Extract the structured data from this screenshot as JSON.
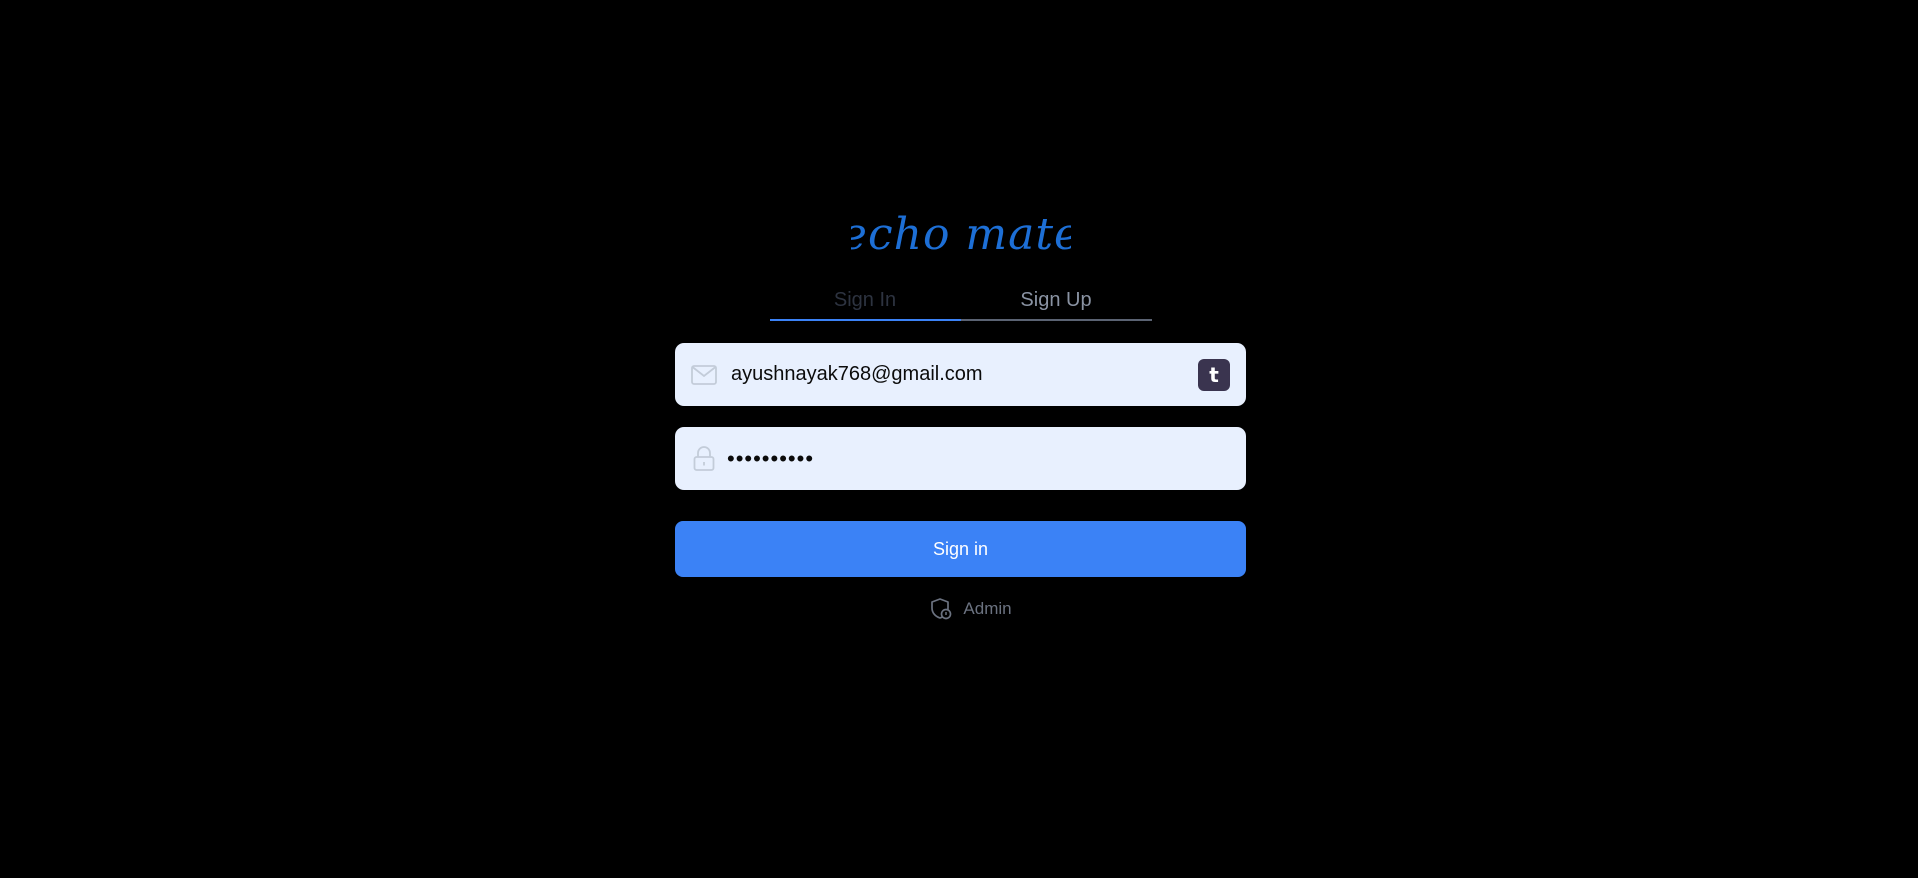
{
  "brand": {
    "logo_text": "echo mate",
    "accent_color": "#3b82f6",
    "logo_color": "#1d6fd6"
  },
  "tabs": [
    {
      "label": "Sign In",
      "active": true
    },
    {
      "label": "Sign Up",
      "active": false
    }
  ],
  "form": {
    "email": {
      "value": "ayushnayak768@gmail.com",
      "icon": "mail-icon"
    },
    "email_extension_badge": "t",
    "password": {
      "value": "••••••••••",
      "icon": "lock-icon"
    },
    "submit_label": "Sign in"
  },
  "admin_link": {
    "label": "Admin",
    "icon": "shield-admin-icon"
  }
}
